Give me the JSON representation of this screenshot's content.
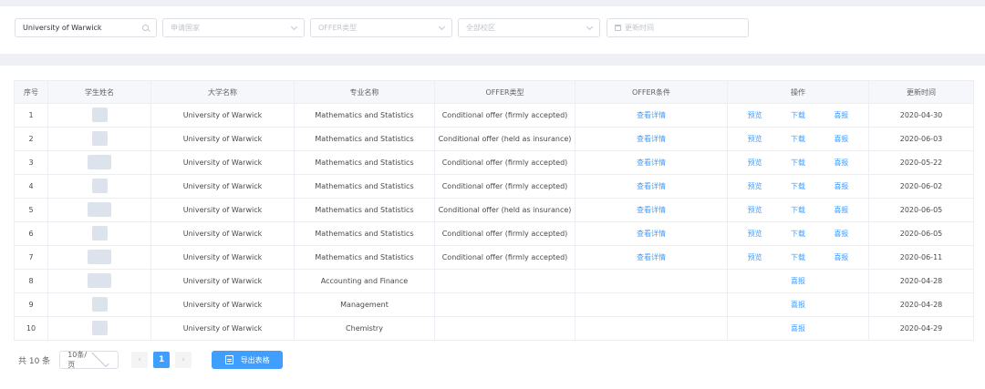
{
  "filters": {
    "university": "University of Warwick",
    "country_placeholder": "申请国家",
    "offer_type_placeholder": "OFFER类型",
    "campus_placeholder": "全部校区",
    "update_time_placeholder": "更新时间"
  },
  "table": {
    "headers": {
      "index": "序号",
      "student": "学生姓名",
      "university": "大学名称",
      "major": "专业名称",
      "offer_type": "OFFER类型",
      "offer_condition": "OFFER条件",
      "actions": "操作",
      "updated": "更新时间"
    },
    "rows": [
      {
        "index": "1",
        "university": "University of Warwick",
        "major": "Mathematics and Statistics",
        "offer_type": "Conditional offer (firmly accepted)",
        "condition": "查看详情",
        "preview": "预览",
        "download": "下载",
        "report": "喜报",
        "updated": "2020-04-30"
      },
      {
        "index": "2",
        "university": "University of Warwick",
        "major": "Mathematics and Statistics",
        "offer_type": "Conditional offer (held as insurance)",
        "condition": "查看详情",
        "preview": "预览",
        "download": "下载",
        "report": "喜报",
        "updated": "2020-06-03"
      },
      {
        "index": "3",
        "university": "University of Warwick",
        "major": "Mathematics and Statistics",
        "offer_type": "Conditional offer (firmly accepted)",
        "condition": "查看详情",
        "preview": "预览",
        "download": "下载",
        "report": "喜报",
        "updated": "2020-05-22"
      },
      {
        "index": "4",
        "university": "University of Warwick",
        "major": "Mathematics and Statistics",
        "offer_type": "Conditional offer (firmly accepted)",
        "condition": "查看详情",
        "preview": "预览",
        "download": "下载",
        "report": "喜报",
        "updated": "2020-06-02"
      },
      {
        "index": "5",
        "university": "University of Warwick",
        "major": "Mathematics and Statistics",
        "offer_type": "Conditional offer (held as insurance)",
        "condition": "查看详情",
        "preview": "预览",
        "download": "下载",
        "report": "喜报",
        "updated": "2020-06-05"
      },
      {
        "index": "6",
        "university": "University of Warwick",
        "major": "Mathematics and Statistics",
        "offer_type": "Conditional offer (firmly accepted)",
        "condition": "查看详情",
        "preview": "预览",
        "download": "下载",
        "report": "喜报",
        "updated": "2020-06-05"
      },
      {
        "index": "7",
        "university": "University of Warwick",
        "major": "Mathematics and Statistics",
        "offer_type": "Conditional offer (firmly accepted)",
        "condition": "查看详情",
        "preview": "预览",
        "download": "下载",
        "report": "喜报",
        "updated": "2020-06-11"
      },
      {
        "index": "8",
        "university": "University of Warwick",
        "major": "Accounting and Finance",
        "offer_type": "",
        "condition": "",
        "preview": "",
        "download": "",
        "report": "喜报",
        "updated": "2020-04-28"
      },
      {
        "index": "9",
        "university": "University of Warwick",
        "major": "Management",
        "offer_type": "",
        "condition": "",
        "preview": "",
        "download": "",
        "report": "喜报",
        "updated": "2020-04-28"
      },
      {
        "index": "10",
        "university": "University of Warwick",
        "major": "Chemistry",
        "offer_type": "",
        "condition": "",
        "preview": "",
        "download": "",
        "report": "喜报",
        "updated": "2020-04-29"
      }
    ]
  },
  "pagination": {
    "total": "共 10 条",
    "page_size": "10条/页",
    "prev": "‹",
    "current": "1",
    "next": "›"
  },
  "export_label": "导出表格",
  "colors": {
    "accent": "#409eff",
    "header_bg": "#f5f7fa",
    "page_bg": "#eef0f5"
  }
}
